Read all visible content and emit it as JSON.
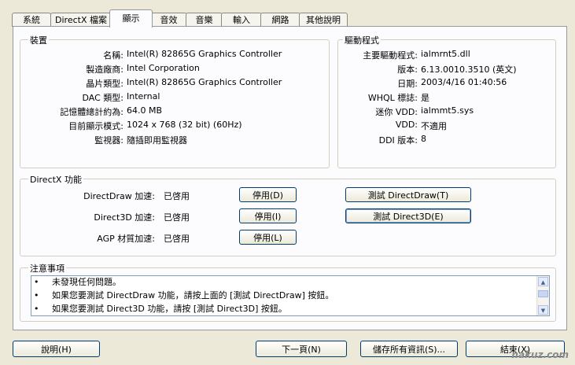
{
  "tabs": [
    "系統",
    "DirectX 檔案",
    "顯示",
    "音效",
    "音樂",
    "輸入",
    "網路",
    "其他說明"
  ],
  "active_tab": 2,
  "device": {
    "title": "裝置",
    "rows": [
      {
        "label": "名稱:",
        "value": "Intel(R) 82865G Graphics Controller"
      },
      {
        "label": "製造廠商:",
        "value": "Intel Corporation"
      },
      {
        "label": "晶片類型:",
        "value": "Intel(R) 82865G Graphics Controller"
      },
      {
        "label": "DAC 類型:",
        "value": "Internal"
      },
      {
        "label": "記憶體總計約為:",
        "value": "64.0 MB"
      },
      {
        "label": "目前顯示模式:",
        "value": "1024 x 768 (32 bit) (60Hz)"
      },
      {
        "label": "監視器:",
        "value": "隨插即用監視器"
      }
    ]
  },
  "driver": {
    "title": "驅動程式",
    "rows": [
      {
        "label": "主要驅動程式:",
        "value": "ialmrnt5.dll"
      },
      {
        "label": "版本:",
        "value": "6.13.0010.3510 (英文)"
      },
      {
        "label": "日期:",
        "value": "2003/4/16 01:40:56"
      },
      {
        "label": "WHQL 標誌:",
        "value": "是"
      },
      {
        "label": "迷你 VDD:",
        "value": "ialmmt5.sys"
      },
      {
        "label": "VDD:",
        "value": "不適用"
      },
      {
        "label": "DDI 版本:",
        "value": "8"
      }
    ]
  },
  "directx": {
    "title": "DirectX 功能",
    "rows": [
      {
        "label": "DirectDraw 加速:",
        "value": "已啓用",
        "disable": "停用(D)",
        "test": "測試 DirectDraw(T)"
      },
      {
        "label": "Direct3D 加速:",
        "value": "已啓用",
        "disable": "停用(I)",
        "test": "測試 Direct3D(E)"
      },
      {
        "label": "AGP 材質加速:",
        "value": "已啓用",
        "disable": "停用(L)"
      }
    ]
  },
  "notes": {
    "title": "注意事項",
    "lines": [
      "未發現任何問題。",
      "如果您要測試 DirectDraw 功能，請按上面的 [測試 DirectDraw] 按鈕。",
      "如果您要測試 Direct3D 功能，請按 [測試 Direct3D] 按鈕。"
    ],
    "bullet": "•"
  },
  "bottom": {
    "help": "說明(H)",
    "next": "下一頁(N)",
    "save": "儲存所有資訊(S)...",
    "exit": "結束(X)"
  },
  "watermark": "nakuz.com"
}
